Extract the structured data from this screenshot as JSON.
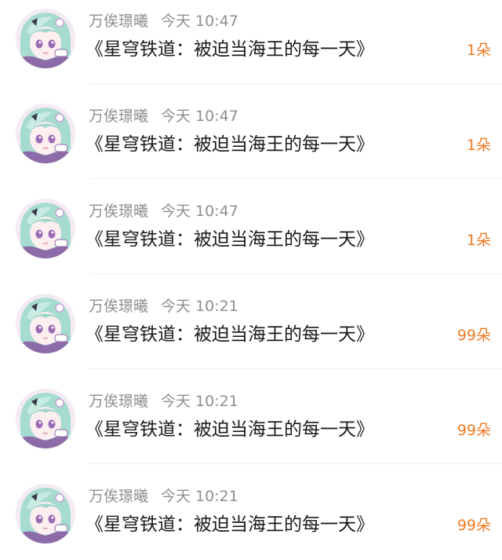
{
  "colors": {
    "name": "#8e8e8e",
    "title": "#1c1c1c",
    "gift": "#f07a25",
    "divider": "#f1f1f1"
  },
  "items": [
    {
      "name": "万俟璟曦",
      "time": "今天 10:47",
      "title": "《星穹铁道：被迫当海王的每一天》",
      "gift": "1朵"
    },
    {
      "name": "万俟璟曦",
      "time": "今天 10:47",
      "title": "《星穹铁道：被迫当海王的每一天》",
      "gift": "1朵"
    },
    {
      "name": "万俟璟曦",
      "time": "今天 10:47",
      "title": "《星穹铁道：被迫当海王的每一天》",
      "gift": "1朵"
    },
    {
      "name": "万俟璟曦",
      "time": "今天 10:21",
      "title": "《星穹铁道：被迫当海王的每一天》",
      "gift": "99朵"
    },
    {
      "name": "万俟璟曦",
      "time": "今天 10:21",
      "title": "《星穹铁道：被迫当海王的每一天》",
      "gift": "99朵"
    },
    {
      "name": "万俟璟曦",
      "time": "今天 10:21",
      "title": "《星穹铁道：被迫当海王的每一天》",
      "gift": "99朵"
    }
  ]
}
